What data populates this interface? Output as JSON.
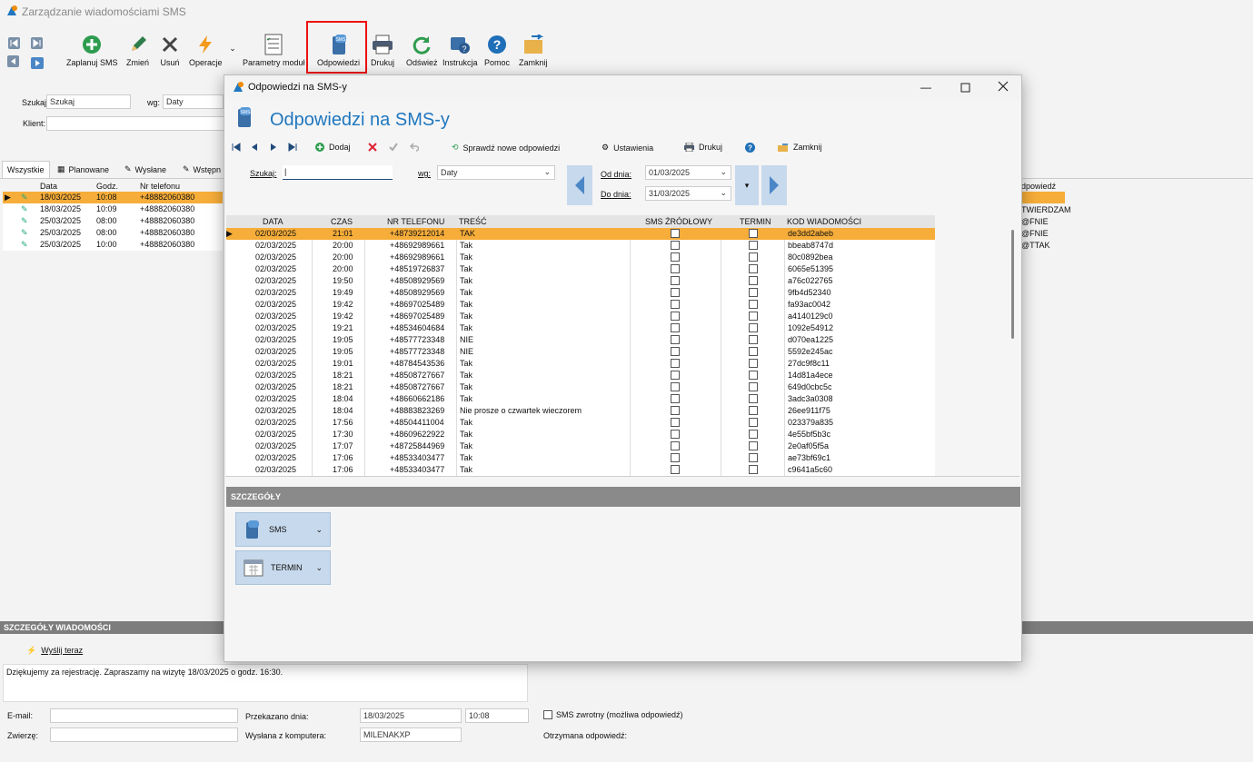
{
  "window": {
    "title": "Zarządzanie wiadomościami SMS"
  },
  "toolbar": {
    "plan": "Zaplanuj SMS",
    "edit": "Zmień",
    "delete": "Usuń",
    "operations": "Operacje",
    "params": "Parametry moduł",
    "replies": "Odpowiedzi",
    "print": "Drukuj",
    "refresh": "Odśwież",
    "instruction": "Instrukcja",
    "help": "Pomoc",
    "close": "Zamknij"
  },
  "filter": {
    "search_label": "Szukaj:",
    "search_placeholder": "Szukaj",
    "by_label": "wg:",
    "by_value": "Daty",
    "client_label": "Klient:"
  },
  "tabs": [
    "Wszystkie",
    "Planowane",
    "Wysłane",
    "Wstępn"
  ],
  "bg_table": {
    "headers": [
      "Data",
      "Godz.",
      "Nr telefonu"
    ],
    "rows": [
      {
        "date": "18/03/2025",
        "time": "10:08",
        "phone": "+48882060380"
      },
      {
        "date": "18/03/2025",
        "time": "10:09",
        "phone": "+48882060380"
      },
      {
        "date": "25/03/2025",
        "time": "08:00",
        "phone": "+48882060380"
      },
      {
        "date": "25/03/2025",
        "time": "08:00",
        "phone": "+48882060380"
      },
      {
        "date": "25/03/2025",
        "time": "10:00",
        "phone": "+48882060380"
      }
    ],
    "right_header": "dpowiedź",
    "right_values": [
      "TWIERDZAM",
      "@FNIE",
      "@FNIE",
      "@TTAK"
    ]
  },
  "modal": {
    "title": "Odpowiedzi na SMS-y",
    "heading": "Odpowiedzi na SMS-y",
    "add": "Dodaj",
    "check_new": "Sprawdź nowe odpowiedzi",
    "settings": "Ustawienia",
    "print": "Drukuj",
    "close": "Zamknij",
    "search_label": "Szukaj:",
    "by_label": "wg:",
    "by_value": "Daty",
    "from_label": "Od dnia:",
    "from_value": "01/03/2025",
    "to_label": "Do dnia:",
    "to_value": "31/03/2025",
    "columns": [
      "DATA",
      "CZAS",
      "NR TELEFONU",
      "TREŚĆ",
      "SMS ŹRÓDŁOWY",
      "TERMIN",
      "KOD WIADOMOŚCI"
    ],
    "rows": [
      {
        "date": "02/03/2025",
        "time": "21:01",
        "phone": "+48739212014",
        "text": "TAK",
        "code": "de3dd2abeb"
      },
      {
        "date": "02/03/2025",
        "time": "20:00",
        "phone": "+48692989661",
        "text": "Tak",
        "code": "bbeab8747d"
      },
      {
        "date": "02/03/2025",
        "time": "20:00",
        "phone": "+48692989661",
        "text": "Tak",
        "code": "80c0892bea"
      },
      {
        "date": "02/03/2025",
        "time": "20:00",
        "phone": "+48519726837",
        "text": "Tak",
        "code": "6065e51395"
      },
      {
        "date": "02/03/2025",
        "time": "19:50",
        "phone": "+48508929569",
        "text": "Tak",
        "code": "a76c022765"
      },
      {
        "date": "02/03/2025",
        "time": "19:49",
        "phone": "+48508929569",
        "text": "Tak",
        "code": "9fb4d52340"
      },
      {
        "date": "02/03/2025",
        "time": "19:42",
        "phone": "+48697025489",
        "text": "Tak",
        "code": "fa93ac0042"
      },
      {
        "date": "02/03/2025",
        "time": "19:42",
        "phone": "+48697025489",
        "text": "Tak",
        "code": "a4140129c0"
      },
      {
        "date": "02/03/2025",
        "time": "19:21",
        "phone": "+48534604684",
        "text": "Tak",
        "code": "1092e54912"
      },
      {
        "date": "02/03/2025",
        "time": "19:05",
        "phone": "+48577723348",
        "text": "NIE",
        "code": "d070ea1225"
      },
      {
        "date": "02/03/2025",
        "time": "19:05",
        "phone": "+48577723348",
        "text": "NIE",
        "code": "5592e245ac"
      },
      {
        "date": "02/03/2025",
        "time": "19:01",
        "phone": "+48784543536",
        "text": "Tak",
        "code": "27dc9f8c11"
      },
      {
        "date": "02/03/2025",
        "time": "18:21",
        "phone": "+48508727667",
        "text": "Tak",
        "code": "14d81a4ece"
      },
      {
        "date": "02/03/2025",
        "time": "18:21",
        "phone": "+48508727667",
        "text": "Tak",
        "code": "649d0cbc5c"
      },
      {
        "date": "02/03/2025",
        "time": "18:04",
        "phone": "+48660662186",
        "text": "Tak",
        "code": "3adc3a0308"
      },
      {
        "date": "02/03/2025",
        "time": "18:04",
        "phone": "+48883823269",
        "text": "Nie prosze o czwartek wieczorem",
        "code": "26ee911f75"
      },
      {
        "date": "02/03/2025",
        "time": "17:56",
        "phone": "+48504411004",
        "text": "Tak",
        "code": "023379a835"
      },
      {
        "date": "02/03/2025",
        "time": "17:30",
        "phone": "+48609622922",
        "text": "Tak",
        "code": "4e55bf5b3c"
      },
      {
        "date": "02/03/2025",
        "time": "17:07",
        "phone": "+48725844969",
        "text": "Tak",
        "code": "2e0af05f5a"
      },
      {
        "date": "02/03/2025",
        "time": "17:06",
        "phone": "+48533403477",
        "text": "Tak",
        "code": "ae73bf69c1"
      },
      {
        "date": "02/03/2025",
        "time": "17:06",
        "phone": "+48533403477",
        "text": "Tak",
        "code": "c9641a5c60"
      }
    ],
    "details_title": "SZCZEGÓŁY",
    "acc_sms": "SMS",
    "acc_term": "TERMIN"
  },
  "bottom": {
    "title": "SZCZEGÓŁY WIADOMOŚCI",
    "send_now": "Wyślij teraz",
    "message": "Dziękujemy za rejestrację. Zapraszamy na wizytę 18/03/2025 o godz. 16:30.",
    "email_label": "E-mail:",
    "pet_label": "Zwierzę:",
    "passed_label": "Przekazano dnia:",
    "passed_date": "18/03/2025",
    "passed_time": "10:08",
    "sent_from_label": "Wysłana z komputera:",
    "sent_from": "MILENAKXP",
    "return_sms": "SMS zwrotny (możliwa odpowiedź)",
    "received": "Otrzymana odpowiedź:"
  },
  "colors": {
    "accent": "#1f77bf",
    "selected_row": "#f6ad39",
    "highlight": "#e11111"
  }
}
